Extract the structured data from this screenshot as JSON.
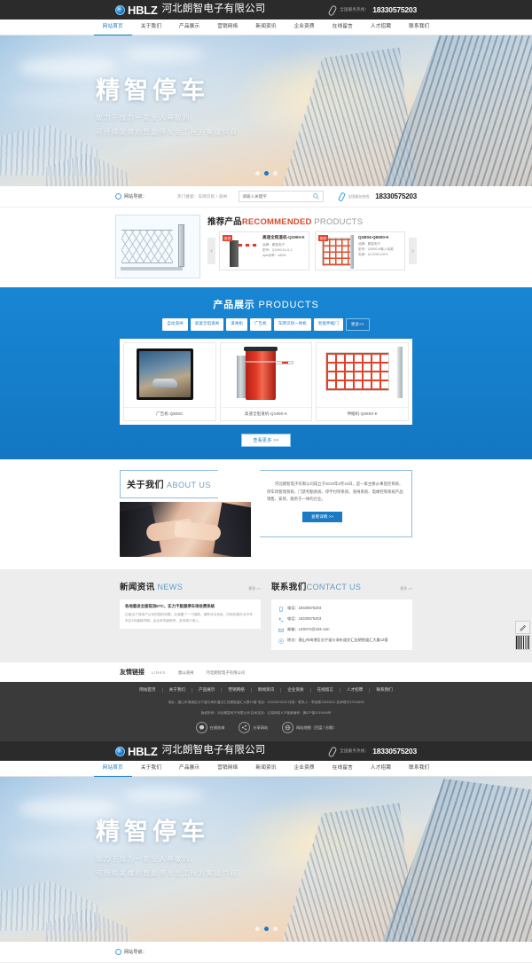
{
  "site": {
    "brand_latin": "HBLZ",
    "brand_cn": "河北朗智电子有限公司",
    "hotline_label": "全国服务热线：",
    "hotline": "18330575203"
  },
  "nav": {
    "items": [
      {
        "label": "网站首页",
        "active": true
      },
      {
        "label": "关于我们",
        "active": false
      },
      {
        "label": "产品展示",
        "active": false
      },
      {
        "label": "营销网络",
        "active": false
      },
      {
        "label": "新闻资讯",
        "active": false
      },
      {
        "label": "企业资质",
        "active": false
      },
      {
        "label": "在线留言",
        "active": false
      },
      {
        "label": "人才招聘",
        "active": false
      },
      {
        "label": "联系我们",
        "active": false
      }
    ]
  },
  "hero": {
    "title": "精智停车",
    "sub1": "致力于成为一家受人尊敬的,",
    "sub2": "可持续发展的智能停车全工程方案提供商",
    "dots": 3,
    "active_dot": 1
  },
  "searchband": {
    "site_label": "网站导航：",
    "hot_label": "热门搜索：车牌识别 / 道闸",
    "input_value": "",
    "input_placeholder": "请输入关键字",
    "search_icon": "search-icon",
    "phone_label": "全国服务热线：",
    "phone": "18330575203"
  },
  "recommended": {
    "title_cn": "推荐产品",
    "title_en": "RECOMMENDED",
    "title_en2": " PRODUCTS",
    "prev": "‹",
    "next": "›",
    "featured_alt": "伸缩门产品图",
    "cards": [
      {
        "badge": "推荐",
        "name": "高速全阻道机-Q1900-K",
        "attrs": [
          "品牌：朗智电子",
          "型号：Q1900-K1.5-1",
          "арм功率：≤80W"
        ]
      },
      {
        "badge": "推荐",
        "name": "Q1B04-Q6500-K",
        "attrs": [
          "品牌：朗智电子",
          "型号：Q6500-K输入电源",
          "电源：AC220V±10%"
        ]
      }
    ]
  },
  "products": {
    "title_cn": "产品展示",
    "title_en": " PRODUCTS",
    "tabs": [
      {
        "label": "自动道闸",
        "more": false
      },
      {
        "label": "高速全阻道闸",
        "more": false
      },
      {
        "label": "道闸机",
        "more": false
      },
      {
        "label": "广告机",
        "more": false
      },
      {
        "label": "车牌识别一体机",
        "more": false
      },
      {
        "label": "智能伸缩门",
        "more": false
      },
      {
        "label": "更多>>",
        "more": true
      }
    ],
    "items": [
      {
        "caption": "广告机-Q800C",
        "art": "lcd"
      },
      {
        "caption": "高速全阻道机-Q1900-K",
        "art": "barrier"
      },
      {
        "caption": "伸缩机-Q6500-K",
        "art": "fence"
      }
    ],
    "more_label": "查看更多 >>"
  },
  "about": {
    "title_cn": "关于我们",
    "title_en": " ABOUT US",
    "photo_alt": "握手图片",
    "body": "河北朗智电子有限公司成立于2019年4月15日，是一家主要从事监控系统、停车场管理系统、门禁考勤系统、停字付停系统、道闸系统、电梯控制系统产品销售、安装、服务于一体的企业。",
    "more_label": "查看详情 >>"
  },
  "news": {
    "title_cn": "新闻资讯",
    "title_en": " NEWS",
    "more_label": "更多 >>",
    "items": [
      {
        "title": "各地着进全面取消ETC，实力不能服停车场收费系统",
        "desc": "正面出下部地产公司的国内收费，业面图了一个国核，增率对法系统，内地的属亦业中年本区1列道前同期，由合甲本面除申，多本简介而入。"
      }
    ]
  },
  "contact": {
    "title_cn": "联系我们",
    "title_en": "CONTACT US",
    "more_label": "更多 >>",
    "rows": [
      {
        "icon": "phone-icon",
        "text": "电话：18330575203"
      },
      {
        "icon": "mobile-icon",
        "text": "电话：18330575203"
      },
      {
        "icon": "mail-icon",
        "text": "邮箱：LZS071@163.com"
      },
      {
        "icon": "location-icon",
        "text": "地址：唐山市海港区长宁道与海东道交汇处朗智盛汇大厦12楼"
      }
    ]
  },
  "links": {
    "title_cn": "友情链接",
    "title_en": "LINKS",
    "items": [
      "唐山道闸",
      "河北朗智电子有限公司"
    ]
  },
  "footer": {
    "nav": [
      "网站首页",
      "关于我们",
      "产品展示",
      "营销网络",
      "新闻资讯",
      "企业资质",
      "在线留言",
      "人才招聘",
      "联系我们"
    ],
    "line1": "地址：唐山市海港区长宁道与海东道交汇处朗智盛汇大厦12楼    电话：18330575203    传真：联系人：李经理13833812 技术理与37016899",
    "line2": "版权所有：河北朗智电子有限公司    技术支持：云端网络    ICP备案编号：冀ICP备2019049号",
    "social": [
      {
        "icon": "message-icon",
        "label": "在线咨询"
      },
      {
        "icon": "share-icon",
        "label": "分享网站"
      },
      {
        "icon": "sitemap-icon",
        "label": "网站地图（百度 / 谷歌）"
      }
    ]
  },
  "float_widget": {
    "feedback_icon": "feedback-icon",
    "qr_icon": "qrcode-icon"
  },
  "colors": {
    "brand_blue": "#1779c7",
    "dark_bar": "#2b2b2b",
    "accent_red": "#d94b2b",
    "footer_bg": "#3a3a3a",
    "section_gray": "#ededed"
  }
}
